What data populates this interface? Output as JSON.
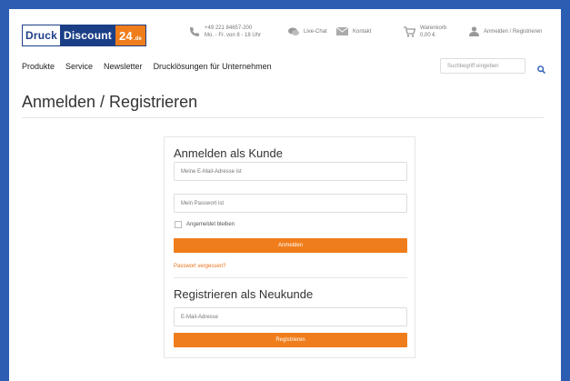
{
  "logo": {
    "part1": "Druck",
    "part2": "Discount",
    "part3": "24",
    "suffix": ".de"
  },
  "topbar": {
    "phone_number": "+49 221 84657-200",
    "phone_hours": "Mo. - Fr. von 8 - 18 Uhr",
    "livechat": "Live-Chat",
    "contact": "Kontakt",
    "cart_label": "Warenkorb",
    "cart_amount": "0,00 €",
    "account": "Anmelden / Registrieren"
  },
  "nav": {
    "items": [
      "Produkte",
      "Service",
      "Newsletter",
      "Drucklösungen für Unternehmen"
    ]
  },
  "search": {
    "placeholder": "Suchbegriff eingeben"
  },
  "page": {
    "title": "Anmelden / Registrieren"
  },
  "login": {
    "heading": "Anmelden als Kunde",
    "email_placeholder": "Meine E-Mail-Adresse ist",
    "password_placeholder": "Mein Passwort ist",
    "remember_label": "Angemeldet bleiben",
    "submit_label": "Anmelden",
    "forgot_label": "Passwort vergessen?"
  },
  "register": {
    "heading": "Registrieren als Neukunde",
    "email_placeholder": "E-Mail-Adresse",
    "submit_label": "Registrieren"
  },
  "colors": {
    "frame": "#2b5db3",
    "accent": "#f07d1b",
    "brand": "#1b3f87"
  }
}
